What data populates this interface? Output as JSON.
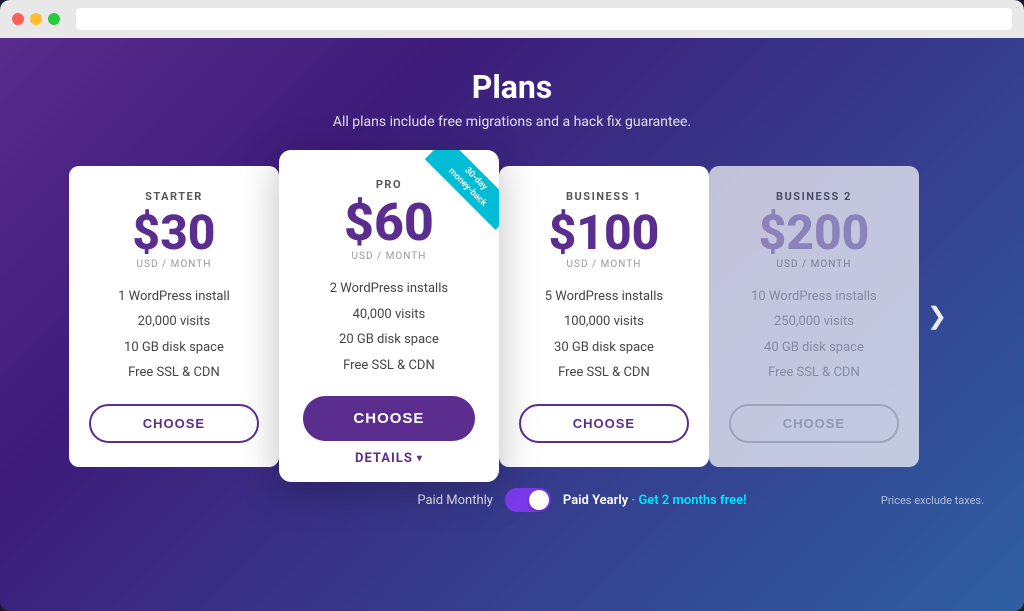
{
  "browser": {
    "dots": [
      "red",
      "yellow",
      "green"
    ]
  },
  "page": {
    "title": "Plans",
    "subtitle": "All plans include free migrations and a hack fix guarantee."
  },
  "plans": [
    {
      "id": "starter",
      "name": "STARTER",
      "price": "$30",
      "period": "USD / MONTH",
      "features": [
        "1 WordPress install",
        "20,000 visits",
        "10 GB disk space",
        "Free SSL & CDN"
      ],
      "button": "CHOOSE",
      "featured": false,
      "faded": false
    },
    {
      "id": "pro",
      "name": "PRO",
      "price": "$60",
      "period": "USD / MONTH",
      "features": [
        "2 WordPress installs",
        "40,000 visits",
        "20 GB disk space",
        "Free SSL & CDN"
      ],
      "button": "CHOOSE",
      "featured": true,
      "faded": false,
      "ribbon": "30-day\nmoney-back"
    },
    {
      "id": "business1",
      "name": "BUSINESS 1",
      "price": "$100",
      "period": "USD / MONTH",
      "features": [
        "5 WordPress installs",
        "100,000 visits",
        "30 GB disk space",
        "Free SSL & CDN"
      ],
      "button": "CHOOSE",
      "featured": false,
      "faded": false
    },
    {
      "id": "business2",
      "name": "BUSINESS 2",
      "price": "$200",
      "period": "USD / MONTH",
      "features": [
        "10 WordPress installs",
        "250,000 visits",
        "40 GB disk space",
        "Free SSL & CDN"
      ],
      "button": "CHOOSE",
      "featured": false,
      "faded": true
    }
  ],
  "details_label": "DETAILS",
  "footer": {
    "monthly_label": "Paid Monthly",
    "yearly_label": "Paid Yearly",
    "yearly_promo": "· Get 2 months free!",
    "taxes_note": "Prices exclude taxes."
  }
}
